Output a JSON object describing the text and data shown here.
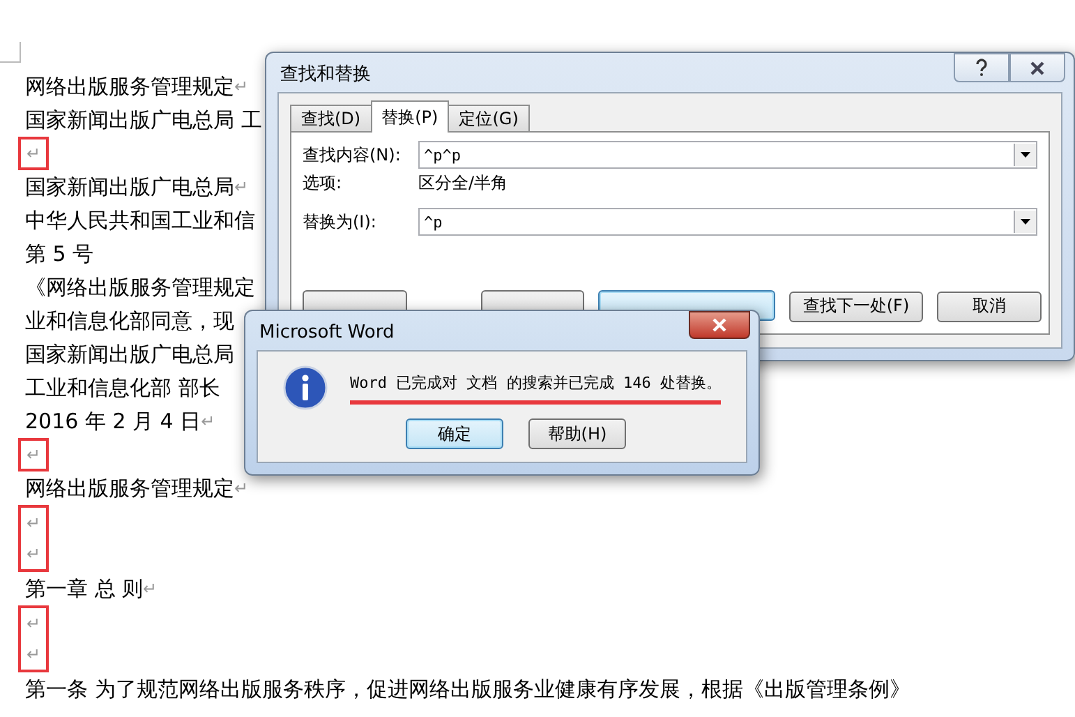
{
  "document": {
    "paragraphs": [
      {
        "kind": "line",
        "text": "网络出版服务管理规定",
        "mark": "↵"
      },
      {
        "kind": "line",
        "text": "国家新闻出版广电总局 工"
      },
      {
        "kind": "flagged",
        "marks": [
          "↵"
        ]
      },
      {
        "kind": "line",
        "text": "国家新闻出版广电总局",
        "mark": "↵"
      },
      {
        "kind": "line",
        "text": "中华人民共和国工业和信"
      },
      {
        "kind": "line",
        "text": "第 5 号"
      },
      {
        "kind": "line",
        "text": "《网络出版服务管理规定"
      },
      {
        "kind": "line",
        "text": "业和信息化部同意，现"
      },
      {
        "kind": "line",
        "text": "国家新闻出版广电总局"
      },
      {
        "kind": "line",
        "text": "工业和信息化部  部长"
      },
      {
        "kind": "line",
        "text": "2016 年 2 月 4 日",
        "mark": "↵"
      },
      {
        "kind": "flagged",
        "marks": [
          "↵"
        ]
      },
      {
        "kind": "line",
        "text": "网络出版服务管理规定",
        "mark": "↵"
      },
      {
        "kind": "flagged",
        "marks": [
          "↵",
          "↵"
        ]
      },
      {
        "kind": "line",
        "text": "第一章  总  则",
        "mark": "↵"
      },
      {
        "kind": "flagged",
        "marks": [
          "↵",
          "↵"
        ]
      },
      {
        "kind": "line",
        "text": "第一条  为了规范网络出版服务秩序，促进网络出版服务业健康有序发展，根据《出版管理条例》"
      }
    ]
  },
  "find_replace_dialog": {
    "title": "查找和替换",
    "tabs": [
      {
        "label": "查找(D)",
        "selected": false
      },
      {
        "label": "替换(P)",
        "selected": true
      },
      {
        "label": "定位(G)",
        "selected": false
      }
    ],
    "find_label": "查找内容(N):",
    "find_value": "^p^p",
    "options_label": "选项:",
    "options_value": "区分全/半角",
    "replace_label": "替换为(I):",
    "replace_value": "^p",
    "buttons": [
      {
        "kind": "hidden",
        "default": false
      },
      {
        "kind": "hidden",
        "default": false
      },
      {
        "kind": "hidden",
        "default": true
      },
      {
        "kind": "text",
        "label": "查找下一处(F)",
        "default": false
      },
      {
        "kind": "text",
        "label": "取消",
        "default": false
      }
    ]
  },
  "message_box": {
    "title": "Microsoft Word",
    "message": "Word 已完成对 文档 的搜索并已完成 146 处替换。",
    "underlined": true,
    "buttons": [
      {
        "label": "确定",
        "default": true
      },
      {
        "label": "帮助(H)",
        "default": false
      }
    ]
  }
}
